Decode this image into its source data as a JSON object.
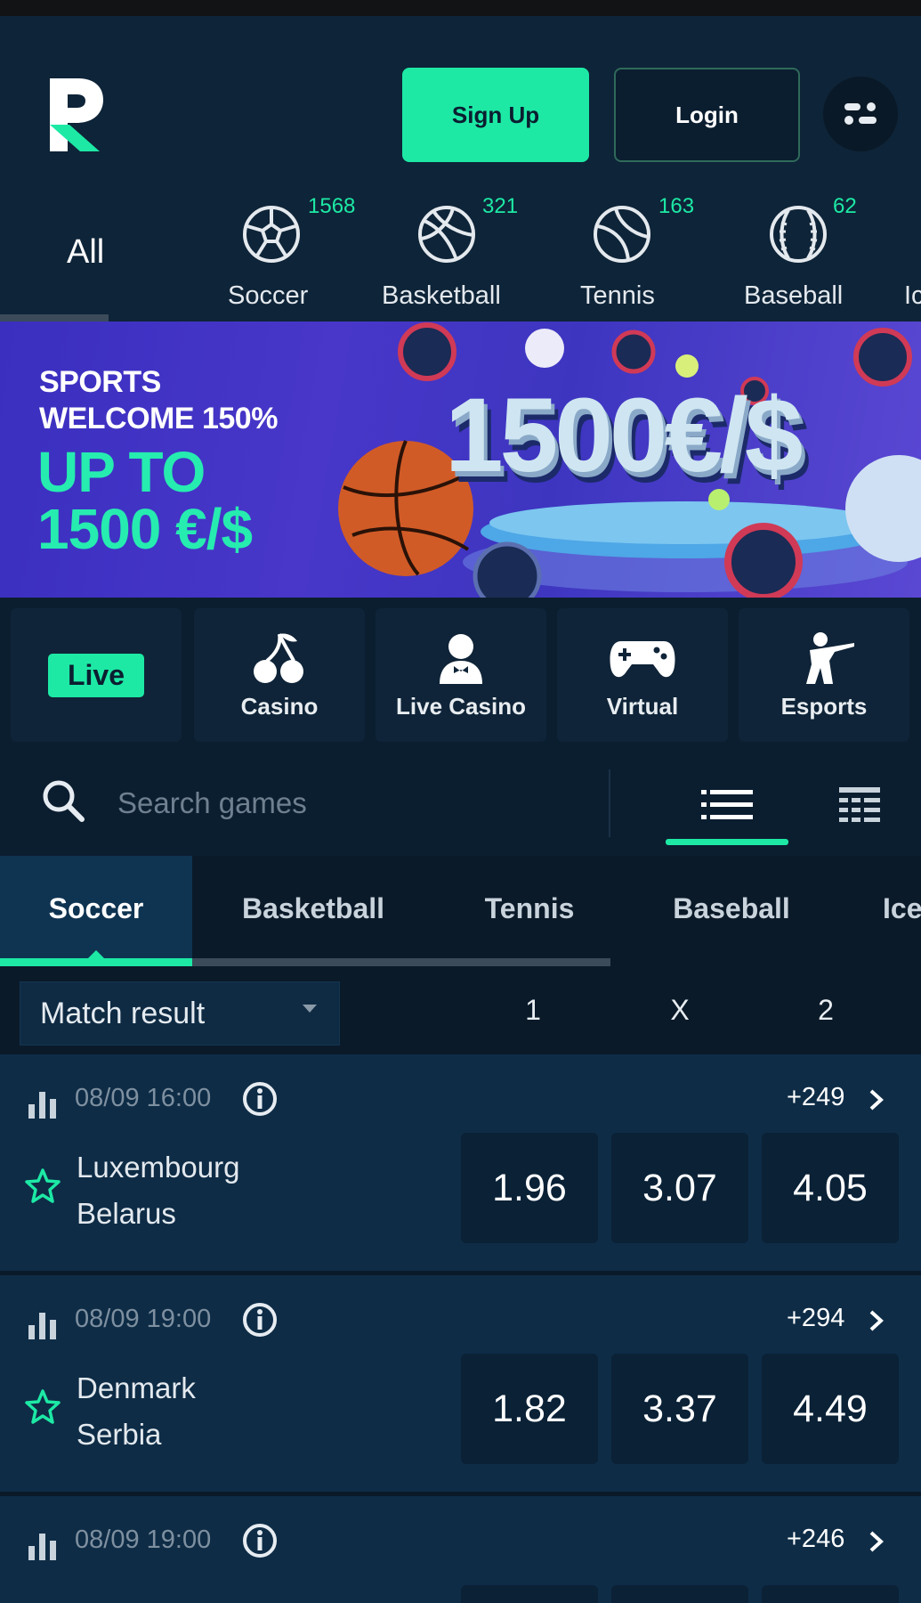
{
  "header": {
    "signup_label": "Sign Up",
    "login_label": "Login"
  },
  "sports_nav": {
    "all_label": "All",
    "items": [
      {
        "label": "Soccer",
        "count": "1568",
        "icon": "soccer-ball-icon"
      },
      {
        "label": "Basketball",
        "count": "321",
        "icon": "basketball-icon"
      },
      {
        "label": "Tennis",
        "count": "163",
        "icon": "tennis-ball-icon"
      },
      {
        "label": "Baseball",
        "count": "62",
        "icon": "baseball-icon"
      },
      {
        "label": "Ic",
        "count": "",
        "icon": ""
      }
    ]
  },
  "banner": {
    "line1": "SPORTS",
    "line2": "WELCOME 150%",
    "line3": "UP TO",
    "line4": "1500 €/$",
    "big_text": "1500€/$"
  },
  "categories": [
    {
      "label": "Live",
      "icon": ""
    },
    {
      "label": "Casino",
      "icon": "cherries-icon"
    },
    {
      "label": "Live Casino",
      "icon": "dealer-icon"
    },
    {
      "label": "Virtual",
      "icon": "gamepad-icon"
    },
    {
      "label": "Esports",
      "icon": "soldier-icon"
    }
  ],
  "search": {
    "placeholder": "Search games"
  },
  "sport_tabs": [
    "Soccer",
    "Basketball",
    "Tennis",
    "Baseball",
    "Ice"
  ],
  "market": {
    "selected": "Match result",
    "columns": [
      "1",
      "X",
      "2"
    ]
  },
  "events": [
    {
      "time": "08/09 16:00",
      "more": "+249",
      "team1": "Luxembourg",
      "team2": "Belarus",
      "odds": [
        "1.96",
        "3.07",
        "4.05"
      ]
    },
    {
      "time": "08/09 19:00",
      "more": "+294",
      "team1": "Denmark",
      "team2": "Serbia",
      "odds": [
        "1.82",
        "3.37",
        "4.49"
      ]
    },
    {
      "time": "08/09 19:00",
      "more": "+246",
      "team1": "",
      "team2": "",
      "odds": [
        "",
        "",
        ""
      ]
    }
  ],
  "colors": {
    "accent": "#1de9a5",
    "background": "#0b1e30",
    "header": "#0e2438",
    "event_row": "#0e2c46"
  }
}
